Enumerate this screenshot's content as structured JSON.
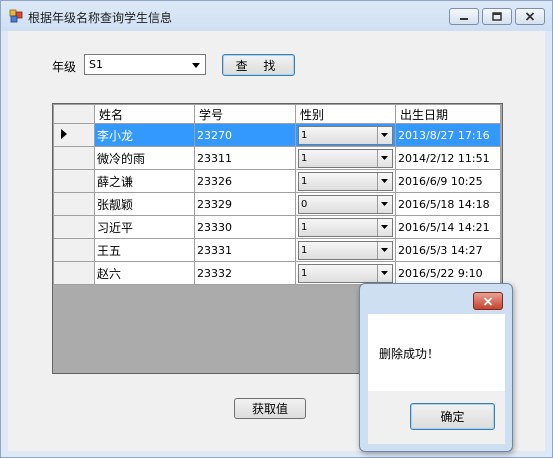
{
  "window": {
    "title": "根据年级名称查询学生信息"
  },
  "form": {
    "grade_label": "年级",
    "grade_selected": "S1",
    "search_label": "查 找",
    "get_value_label": "获取值"
  },
  "grid": {
    "columns": [
      "姓名",
      "学号",
      "性别",
      "出生日期"
    ],
    "selected_row": 0,
    "rows": [
      {
        "name": "李小龙",
        "id": "23270",
        "gender": "1",
        "birth": "2013/8/27 17:16"
      },
      {
        "name": "微冷的雨",
        "id": "23311",
        "gender": "1",
        "birth": "2014/2/12 11:51"
      },
      {
        "name": "薛之谦",
        "id": "23326",
        "gender": "1",
        "birth": "2016/6/9 10:25"
      },
      {
        "name": "张靓颖",
        "id": "23329",
        "gender": "0",
        "birth": "2016/5/18 14:18"
      },
      {
        "name": "习近平",
        "id": "23330",
        "gender": "1",
        "birth": "2016/5/14 14:21"
      },
      {
        "name": "王五",
        "id": "23331",
        "gender": "1",
        "birth": "2016/5/3 14:27"
      },
      {
        "name": "赵六",
        "id": "23332",
        "gender": "1",
        "birth": "2016/5/22 9:10"
      }
    ]
  },
  "dialog": {
    "message": "删除成功！",
    "ok_label": "确定"
  },
  "colors": {
    "selection": "#3399ff",
    "titlebar": "#cfdff2",
    "close_button": "#c7432f"
  },
  "icons": [
    "app-icon",
    "minimize-icon",
    "maximize-icon",
    "close-icon",
    "dropdown-arrow-icon",
    "current-row-arrow-icon"
  ]
}
